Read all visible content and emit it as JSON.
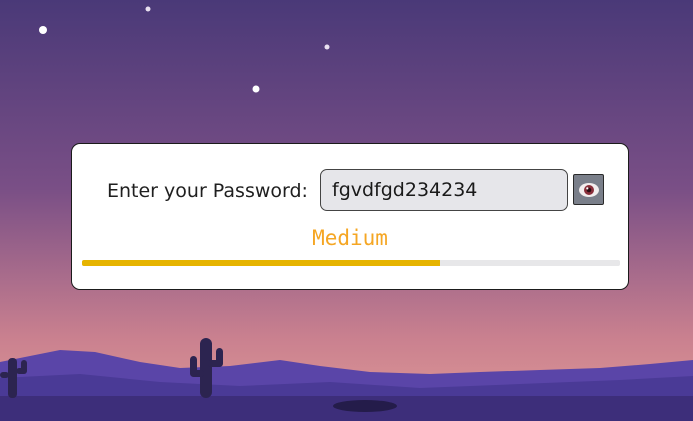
{
  "form": {
    "label": "Enter your Password:",
    "password_value": "fgvdfgd234234",
    "show_password_icon": "eye-icon"
  },
  "strength": {
    "text": "Medium",
    "level_fraction": 0.665,
    "text_color": "#f5a623",
    "bar_color": "#e6b400",
    "track_color": "#e7e7e9"
  },
  "background": {
    "sky_top": "#4a3978",
    "sky_bottom": "#d98b92",
    "hills_color": "#5a45a8",
    "ground_color": "#3d2e7a",
    "cactus_color": "#2c2450"
  }
}
